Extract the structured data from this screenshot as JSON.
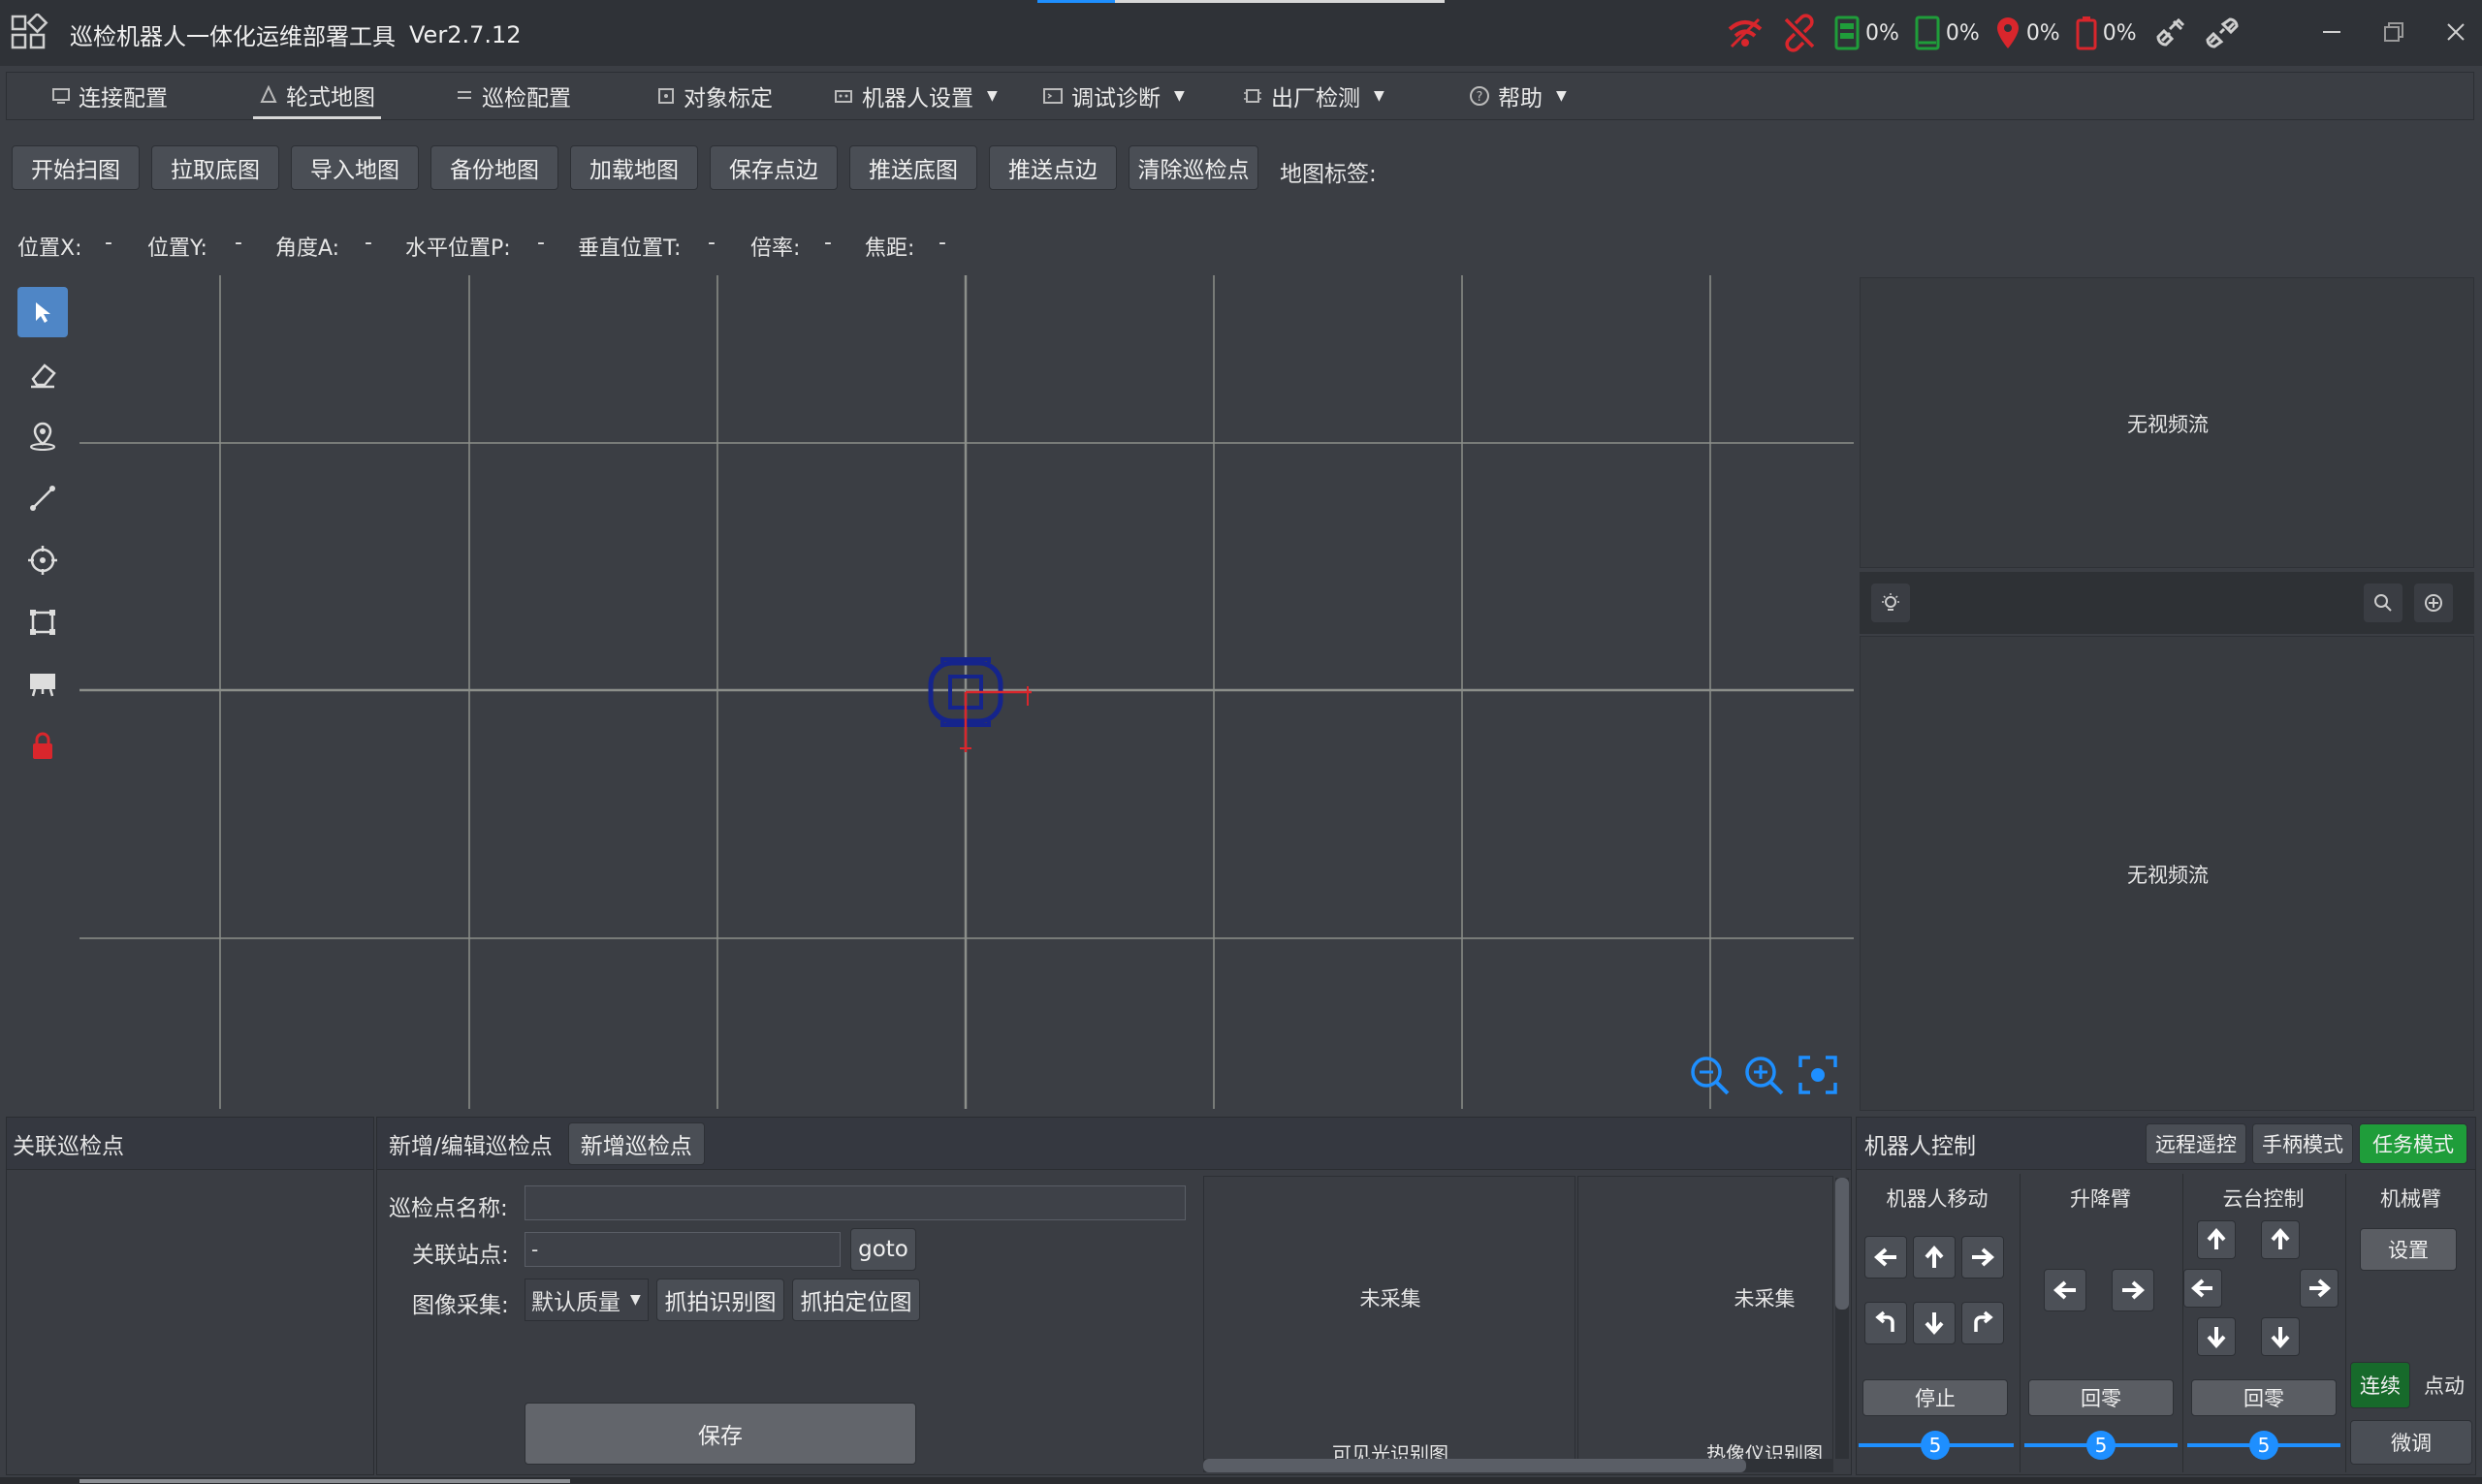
{
  "app": {
    "title": "巡检机器人一体化运维部署工具",
    "version": "Ver2.7.12"
  },
  "status": {
    "storage1": "0%",
    "storage2": "0%",
    "location": "0%",
    "battery": "0%"
  },
  "menu": [
    {
      "label": "连接配置",
      "icon": "monitor-icon"
    },
    {
      "label": "轮式地图",
      "icon": "map-icon"
    },
    {
      "label": "巡检配置",
      "icon": "inspect-icon"
    },
    {
      "label": "对象标定",
      "icon": "target-icon"
    },
    {
      "label": "机器人设置",
      "icon": "robot-icon"
    },
    {
      "label": "调试诊断",
      "icon": "debug-icon"
    },
    {
      "label": "出厂检测",
      "icon": "chip-icon"
    },
    {
      "label": "帮助",
      "icon": "help-icon"
    }
  ],
  "toolbar": {
    "buttons": [
      "开始扫图",
      "拉取底图",
      "导入地图",
      "备份地图",
      "加载地图",
      "保存点边",
      "推送底图",
      "推送点边",
      "清除巡检点"
    ],
    "map_tag_label": "地图标签:"
  },
  "info": {
    "pos_x_label": "位置X:",
    "pos_x": "-",
    "pos_y_label": "位置Y:",
    "pos_y": "-",
    "angle_label": "角度A:",
    "angle": "-",
    "pan_label": "水平位置P:",
    "pan": "-",
    "tilt_label": "垂直位置T:",
    "tilt": "-",
    "zoom_label": "倍率:",
    "zoom": "-",
    "focus_label": "焦距:",
    "focus": "-"
  },
  "video": {
    "no_stream_1": "无视频流",
    "no_stream_2": "无视频流"
  },
  "left_panel": {
    "title": "关联巡检点"
  },
  "edit_panel": {
    "tab_edit": "新增/编辑巡检点",
    "tab_new": "新增巡检点",
    "name_label": "巡检点名称:",
    "name_value": "",
    "station_label": "关联站点:",
    "station_value": "-",
    "goto_label": "goto",
    "capture_label": "图像采集:",
    "quality_value": "默认质量",
    "capture_recog": "抓拍识别图",
    "capture_locate": "抓拍定位图",
    "save_label": "保存",
    "img1_status": "未采集",
    "img1_caption": "可见光识别图",
    "img2_status": "未采集",
    "img2_caption": "热像仪识别图"
  },
  "robot_control": {
    "title": "机器人控制",
    "mode_remote": "远程遥控",
    "mode_joystick": "手柄模式",
    "mode_task": "任务模式",
    "move_title": "机器人移动",
    "lift_title": "升降臂",
    "ptz_title": "云台控制",
    "arm_title": "机械臂",
    "stop_label": "停止",
    "lift_zero_label": "回零",
    "ptz_zero_label": "回零",
    "arm_settings_label": "设置",
    "continuous_label": "连续",
    "jog_label": "点动",
    "fine_label": "微调",
    "move_speed": "5",
    "lift_speed": "5",
    "ptz_speed": "5"
  },
  "colors": {
    "accent": "#1e8fff",
    "active_green": "#1f9d3a",
    "status_red": "#d9262c"
  }
}
